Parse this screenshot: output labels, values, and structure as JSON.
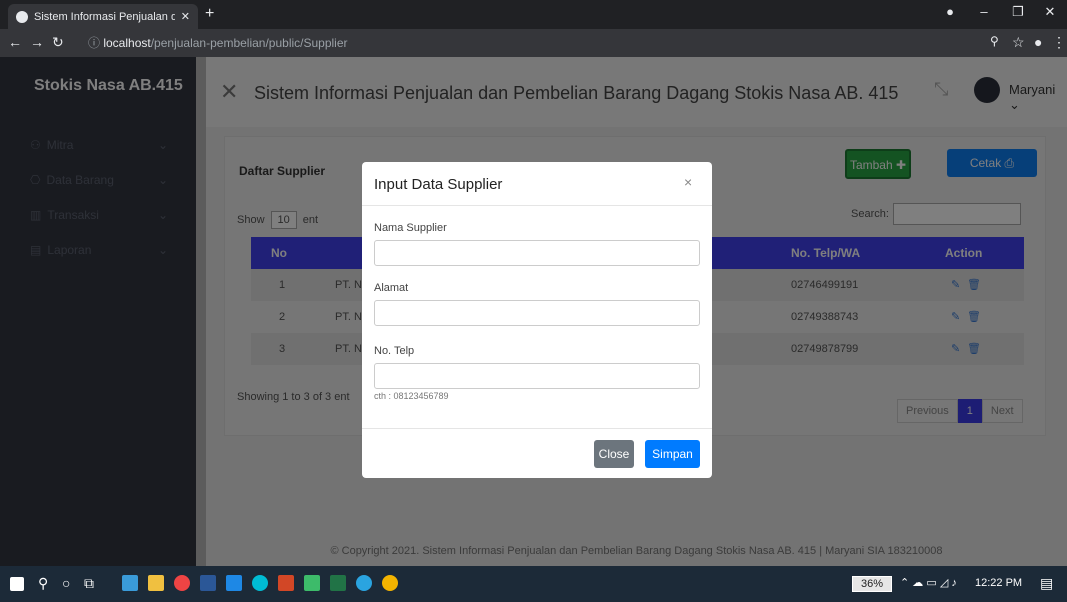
{
  "browser": {
    "tab_title": "Sistem Informasi Penjualan dan P",
    "new_tab": "+",
    "url_host": "localhost",
    "url_path": "/penjualan-pembelian/public/Supplier"
  },
  "sidebar": {
    "brand": "Stokis Nasa AB.415",
    "items": [
      {
        "label": "Mitra",
        "icon": "user-icon"
      },
      {
        "label": "Data Barang",
        "icon": "box-icon"
      },
      {
        "label": "Transaksi",
        "icon": "chart-icon"
      },
      {
        "label": "Laporan",
        "icon": "document-icon"
      }
    ]
  },
  "header": {
    "title": "Sistem Informasi Penjualan dan Pembelian Barang Dagang Stokis Nasa AB. 415",
    "user": "Maryani"
  },
  "card": {
    "title": "Daftar Supplier",
    "add_label": "Tambah",
    "print_label": "Cetak",
    "show_label": "Show",
    "show_value": "10",
    "entries_label": "ent",
    "search_label": "Search:",
    "columns": {
      "no": "No",
      "phone": "No. Telp/WA",
      "action": "Action"
    },
    "rows": [
      {
        "no": "1",
        "name": "PT. N",
        "phone": "02746499191"
      },
      {
        "no": "2",
        "name": "PT. N",
        "phone": "02749388743"
      },
      {
        "no": "3",
        "name": "PT. N",
        "phone": "02749878799"
      }
    ],
    "info": "Showing 1 to 3 of 3 ent",
    "pager": {
      "prev": "Previous",
      "page": "1",
      "next": "Next"
    }
  },
  "footer": "© Copyright 2021. Sistem Informasi Penjualan dan Pembelian Barang Dagang Stokis Nasa AB. 415 | Maryani SIA 183210008",
  "modal": {
    "title": "Input Data Supplier",
    "close_x": "×",
    "fields": [
      {
        "label": "Nama Supplier",
        "value": ""
      },
      {
        "label": "Alamat",
        "value": ""
      },
      {
        "label": "No. Telp",
        "value": ""
      }
    ],
    "hint": "cth : 08123456789",
    "close_label": "Close",
    "save_label": "Simpan"
  },
  "taskbar": {
    "battery": "36%",
    "time": "12:22 PM"
  },
  "colors": {
    "sidebar": "#333641",
    "table_header": "#4040ee",
    "add_button": "#28a745",
    "primary": "#007bff"
  }
}
